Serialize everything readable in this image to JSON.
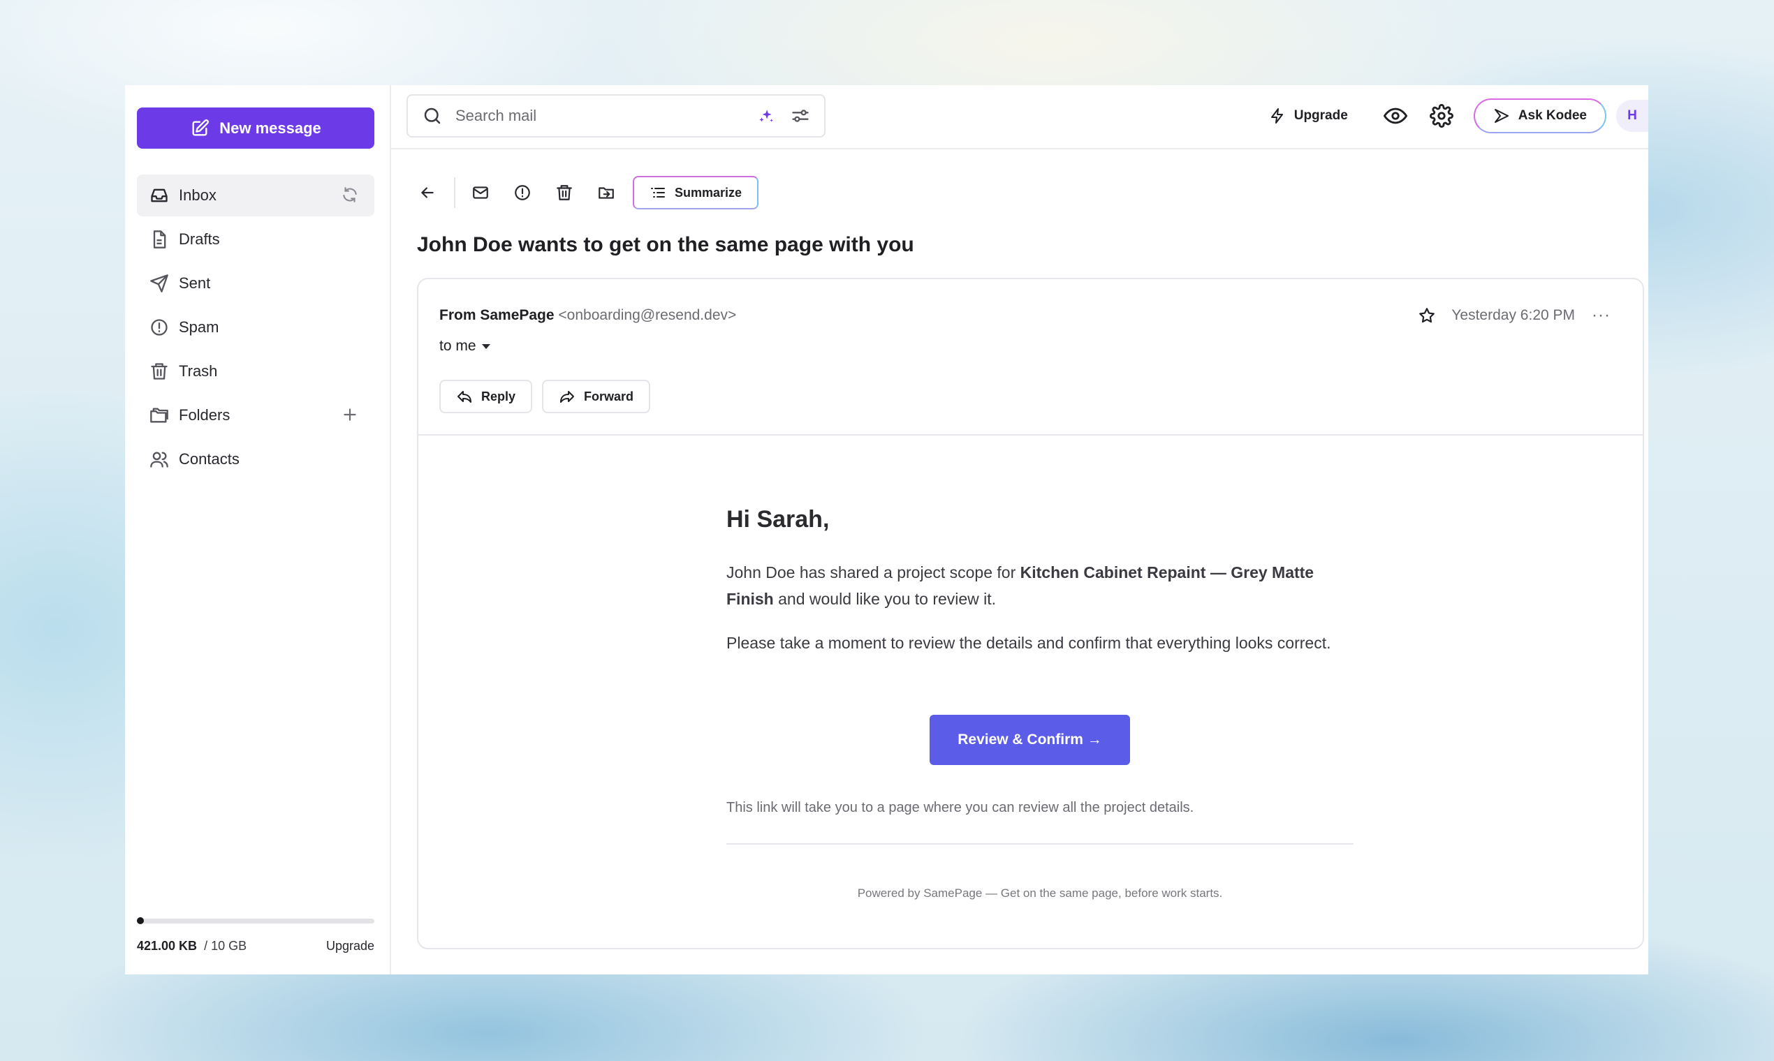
{
  "sidebar": {
    "new_message": "New message",
    "items": [
      {
        "label": "Inbox"
      },
      {
        "label": "Drafts"
      },
      {
        "label": "Sent"
      },
      {
        "label": "Spam"
      },
      {
        "label": "Trash"
      },
      {
        "label": "Folders"
      },
      {
        "label": "Contacts"
      }
    ],
    "storage": {
      "used": "421.00 KB",
      "total": "/ 10 GB",
      "upgrade": "Upgrade",
      "used_fraction": 4e-05
    }
  },
  "topbar": {
    "search_placeholder": "Search mail",
    "upgrade": "Upgrade",
    "ask": "Ask Kodee",
    "avatar_initial": "H"
  },
  "toolbar": {
    "summarize": "Summarize"
  },
  "email": {
    "subject": "John Doe wants to get on the same page with you",
    "from_label": "From SamePage",
    "from_address": "<onboarding@resend.dev>",
    "to": "to me",
    "time": "Yesterday 6:20 PM",
    "more": "···",
    "reply": "Reply",
    "forward": "Forward",
    "greeting": "Hi Sarah,",
    "p1_before": "John Doe has shared a project scope for ",
    "p1_bold": "Kitchen Cabinet Repaint — Grey Matte Finish",
    "p1_after": " and would like you to review it.",
    "p2": "Please take a moment to review the details and confirm that everything looks correct.",
    "cta": "Review & Confirm →",
    "note": "This link will take you to a page where you can review all the project details.",
    "footer": "Powered by SamePage — Get on the same page, before work starts."
  },
  "colors": {
    "accent": "#6d3ae8",
    "cta": "#5b5ce8"
  }
}
